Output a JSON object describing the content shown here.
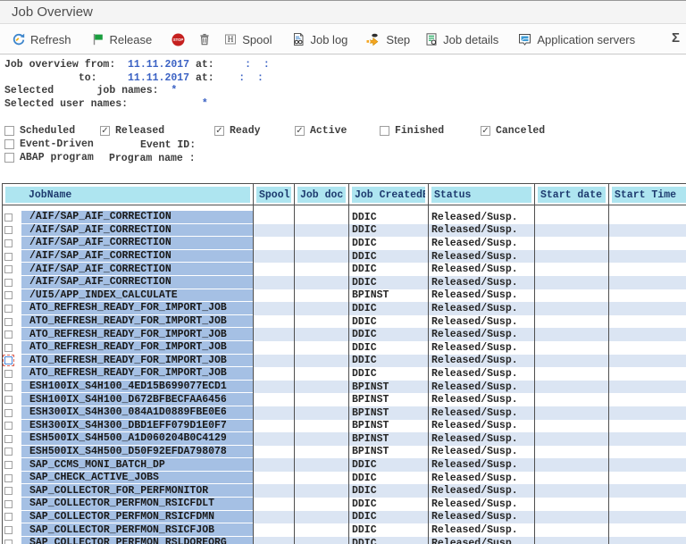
{
  "window": {
    "title": "Job Overview"
  },
  "toolbar": {
    "buttons": [
      {
        "icon": "refresh-icon",
        "label": "Refresh"
      },
      {
        "icon": "release-flag-icon",
        "label": "Release"
      },
      {
        "icon": "stop-icon",
        "label": ""
      },
      {
        "icon": "delete-trash-icon",
        "label": ""
      },
      {
        "icon": "spool-icon",
        "label": "Spool"
      },
      {
        "icon": "job-log-icon",
        "label": "Job log"
      },
      {
        "icon": "step-icon",
        "label": "Step"
      },
      {
        "icon": "job-details-icon",
        "label": "Job details"
      },
      {
        "icon": "application-servers-icon",
        "label": "Application servers"
      },
      {
        "icon": "sum-icon",
        "label": ""
      }
    ]
  },
  "criteria": {
    "lines": [
      [
        {
          "t": "Job overview from:  ",
          "c": "l"
        },
        {
          "t": "11.11.2017",
          "c": "v"
        },
        {
          "t": " at:",
          "c": "l"
        },
        {
          "t": "     :  :",
          "c": "v"
        }
      ],
      [
        {
          "t": "            to:     ",
          "c": "l"
        },
        {
          "t": "11.11.2017",
          "c": "v"
        },
        {
          "t": " at:",
          "c": "l"
        },
        {
          "t": "    :  :",
          "c": "v"
        }
      ],
      [
        {
          "t": "Selected       job names:  ",
          "c": "l"
        },
        {
          "t": "*",
          "c": "v"
        }
      ],
      [
        {
          "t": "Selected user names:            ",
          "c": "l"
        },
        {
          "t": "*",
          "c": "v"
        }
      ]
    ]
  },
  "filters": {
    "status": [
      {
        "label": "Scheduled",
        "checked": false
      },
      {
        "label": "Released",
        "checked": true
      },
      {
        "label": "Ready",
        "checked": true
      },
      {
        "label": "Active",
        "checked": true
      },
      {
        "label": "Finished",
        "checked": false
      },
      {
        "label": "Canceled",
        "checked": true
      }
    ],
    "event_driven": {
      "label": "Event-Driven",
      "checked": false
    },
    "event_id_label": "Event ID:",
    "abap_program": {
      "label": "ABAP program",
      "checked": false
    },
    "program_name_label": "Program name :"
  },
  "table": {
    "columns": [
      "JobName",
      "Spool",
      "Job doc",
      "Job CreatedB",
      "Status",
      "Start date",
      "Start Time"
    ],
    "rows": [
      {
        "name": "/AIF/SAP_AIF_CORRECTION",
        "created_by": "DDIC",
        "status": "Released/Susp."
      },
      {
        "name": "/AIF/SAP_AIF_CORRECTION",
        "created_by": "DDIC",
        "status": "Released/Susp."
      },
      {
        "name": "/AIF/SAP_AIF_CORRECTION",
        "created_by": "DDIC",
        "status": "Released/Susp."
      },
      {
        "name": "/AIF/SAP_AIF_CORRECTION",
        "created_by": "DDIC",
        "status": "Released/Susp."
      },
      {
        "name": "/AIF/SAP_AIF_CORRECTION",
        "created_by": "DDIC",
        "status": "Released/Susp."
      },
      {
        "name": "/AIF/SAP_AIF_CORRECTION",
        "created_by": "DDIC",
        "status": "Released/Susp."
      },
      {
        "name": "/UI5/APP_INDEX_CALCULATE",
        "created_by": "BPINST",
        "status": "Released/Susp."
      },
      {
        "name": "ATO_REFRESH_READY_FOR_IMPORT_JOB",
        "created_by": "DDIC",
        "status": "Released/Susp."
      },
      {
        "name": "ATO_REFRESH_READY_FOR_IMPORT_JOB",
        "created_by": "DDIC",
        "status": "Released/Susp."
      },
      {
        "name": "ATO_REFRESH_READY_FOR_IMPORT_JOB",
        "created_by": "DDIC",
        "status": "Released/Susp."
      },
      {
        "name": "ATO_REFRESH_READY_FOR_IMPORT_JOB",
        "created_by": "DDIC",
        "status": "Released/Susp."
      },
      {
        "name": "ATO_REFRESH_READY_FOR_IMPORT_JOB",
        "created_by": "DDIC",
        "status": "Released/Susp.",
        "focused": true
      },
      {
        "name": "ATO_REFRESH_READY_FOR_IMPORT_JOB",
        "created_by": "DDIC",
        "status": "Released/Susp."
      },
      {
        "name": "ESH100IX_S4H100_4ED15B699077ECD1",
        "created_by": "BPINST",
        "status": "Released/Susp."
      },
      {
        "name": "ESH100IX_S4H100_D672BFBECFAA6456",
        "created_by": "BPINST",
        "status": "Released/Susp."
      },
      {
        "name": "ESH300IX_S4H300_084A1D0889FBE0E6",
        "created_by": "BPINST",
        "status": "Released/Susp."
      },
      {
        "name": "ESH300IX_S4H300_DBD1EFF079D1E0F7",
        "created_by": "BPINST",
        "status": "Released/Susp."
      },
      {
        "name": "ESH500IX_S4H500_A1D060204B0C4129",
        "created_by": "BPINST",
        "status": "Released/Susp."
      },
      {
        "name": "ESH500IX_S4H500_D50F92EFDA798078",
        "created_by": "BPINST",
        "status": "Released/Susp."
      },
      {
        "name": "SAP_CCMS_MONI_BATCH_DP",
        "created_by": "DDIC",
        "status": "Released/Susp."
      },
      {
        "name": "SAP_CHECK_ACTIVE_JOBS",
        "created_by": "DDIC",
        "status": "Released/Susp."
      },
      {
        "name": "SAP_COLLECTOR_FOR_PERFMONITOR",
        "created_by": "DDIC",
        "status": "Released/Susp."
      },
      {
        "name": "SAP_COLLECTOR_PERFMON_RSICFDLT",
        "created_by": "DDIC",
        "status": "Released/Susp."
      },
      {
        "name": "SAP_COLLECTOR_PERFMON_RSICFDMN",
        "created_by": "DDIC",
        "status": "Released/Susp."
      },
      {
        "name": "SAP_COLLECTOR_PERFMON_RSICFJOB",
        "created_by": "DDIC",
        "status": "Released/Susp."
      },
      {
        "name": "SAP_COLLECTOR_PERFMON_RSLDOREORG",
        "created_by": "DDIC",
        "status": "Released/Susp."
      }
    ]
  },
  "colors": {
    "header_bg": "#aee5f0",
    "key_column_bg": "#a5c0e4",
    "row_stripe": "#dbe5f3",
    "value_text": "#3b62c4",
    "border_dark": "#4f4f4f"
  }
}
